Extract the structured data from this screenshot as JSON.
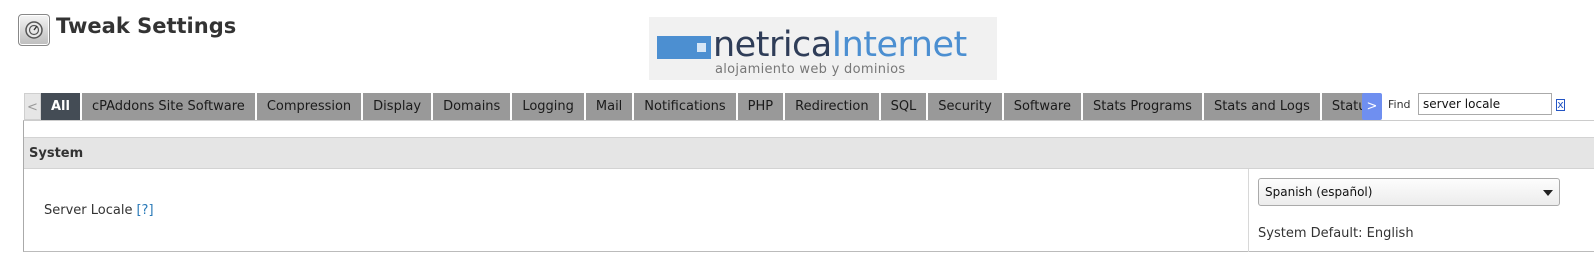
{
  "header": {
    "title": "Tweak Settings",
    "title_icon": "tweak-settings-icon"
  },
  "logo": {
    "word_1": "netrica",
    "word_2": "Internet",
    "tagline": "alojamiento web y dominios",
    "colors": {
      "dark": "#2f3d58",
      "blue": "#4c8fd1"
    }
  },
  "tabs": {
    "scroll_left": "<",
    "scroll_right": ">",
    "items": [
      {
        "label": "All",
        "active": true
      },
      {
        "label": "cPAddons Site Software"
      },
      {
        "label": "Compression"
      },
      {
        "label": "Display"
      },
      {
        "label": "Domains"
      },
      {
        "label": "Logging"
      },
      {
        "label": "Mail"
      },
      {
        "label": "Notifications"
      },
      {
        "label": "PHP"
      },
      {
        "label": "Redirection"
      },
      {
        "label": "SQL"
      },
      {
        "label": "Security"
      },
      {
        "label": "Software"
      },
      {
        "label": "Stats Programs"
      },
      {
        "label": "Stats and Logs"
      },
      {
        "label": "Status"
      }
    ]
  },
  "find": {
    "label": "Find",
    "value": "server locale",
    "clear": "x"
  },
  "section": {
    "title": "System",
    "setting": {
      "name": "Server Locale",
      "help": "[?]",
      "selected_value": "Spanish (español)",
      "default_text": "System Default: English"
    }
  },
  "colors": {
    "tab_bg": "#999999",
    "tab_active_bg": "#444c55",
    "section_header_bg": "#e5e5e5",
    "link": "#2a7ab8",
    "scroll_button": "#6f8ff0"
  }
}
